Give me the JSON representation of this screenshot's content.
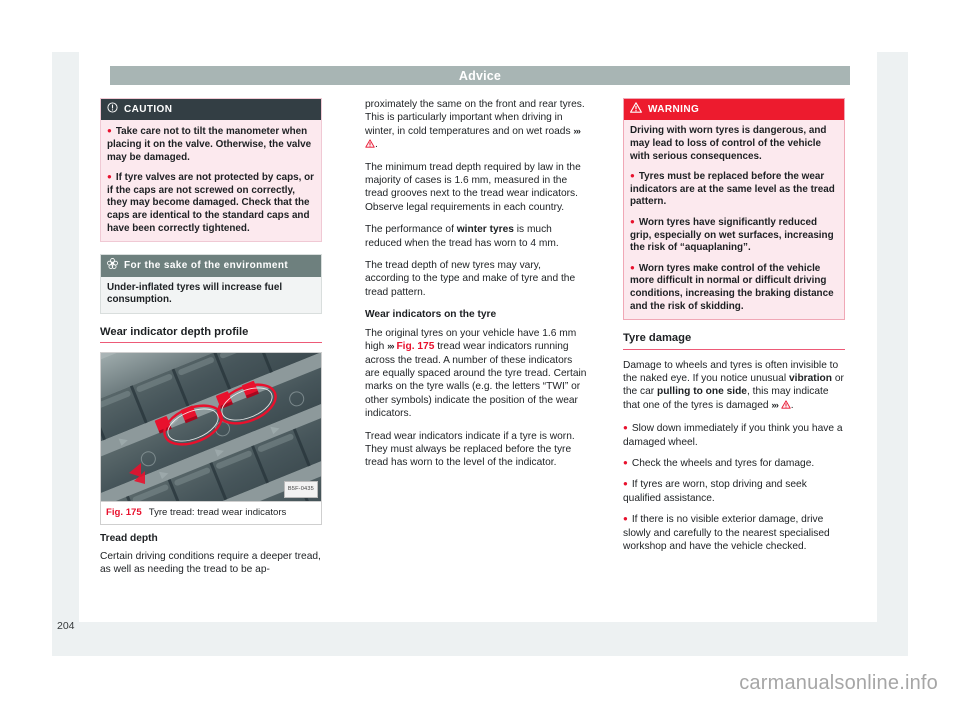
{
  "header": {
    "title": "Advice"
  },
  "page_number": "204",
  "watermark": "carmanualsonline.info",
  "column_left": {
    "caution_box": {
      "icon": "caution-circle-icon",
      "title": "CAUTION",
      "bullets": [
        "Take care not to tilt the manometer when placing it on the valve. Otherwise, the valve may be damaged.",
        "If tyre valves are not protected by caps, or if the caps are not screwed on correctly, they may become damaged. Check that the caps are identical to the standard caps and have been correctly tightened."
      ]
    },
    "environment_box": {
      "icon": "environment-flower-icon",
      "title": "For the sake of the environment",
      "text": "Under-inflated tyres will increase fuel consumption."
    },
    "section_title": "Wear indicator depth profile",
    "figure": {
      "label": "Fig. 175",
      "caption": "Tyre tread: tread wear indicators",
      "image_id": "B5F-0435",
      "alt": "Close-up of tyre tread with two red-circled tread wear indicators"
    },
    "subsection_title": "Tread depth",
    "body_text": "Certain driving conditions require a deeper tread, as well as needing the tread to be ap-"
  },
  "column_middle": {
    "para_1": "proximately the same on the front and rear tyres. This is particularly important when driving in winter, in cold temperatures and on wet roads",
    "para_1_ref_chevrons": "›››",
    "para_1_ref_icon": "warning-triangle-icon",
    "para_2": "The minimum tread depth required by law in the majority of cases is 1.6 mm, measured in the tread grooves next to the tread wear indicators. Observe legal requirements in each country.",
    "para_3_pre": "The performance of ",
    "para_3_bold": "winter tyres",
    "para_3_post": " is much reduced when the tread has worn to 4 mm.",
    "para_4": "The tread depth of new tyres may vary, according to the type and make of tyre and the tread pattern.",
    "subsection_title": "Wear indicators on the tyre",
    "para_5_pre": "The original tyres on your vehicle have 1.6 mm high ",
    "para_5_chevrons": "›››",
    "para_5_ref": "Fig. 175",
    "para_5_post": " tread wear indicators running across the tread. A number of these indicators are equally spaced around the tyre tread. Certain marks on the tyre walls (e.g. the letters “TWI” or other symbols) indicate the position of the wear indicators.",
    "para_6": "Tread wear indicators indicate if a tyre is worn. They must always be replaced before the tyre tread has worn to the level of the indicator."
  },
  "column_right": {
    "warning_box": {
      "icon": "warning-triangle-icon",
      "title": "WARNING",
      "intro": "Driving with worn tyres is dangerous, and may lead to loss of control of the vehicle with serious consequences.",
      "bullets": [
        "Tyres must be replaced before the wear indicators are at the same level as the tread pattern.",
        "Worn tyres have significantly reduced grip, especially on wet surfaces, increasing the risk of “aquaplaning”.",
        "Worn tyres make control of the vehicle more difficult in normal or difficult driving conditions, increasing the braking distance and the risk of skidding."
      ]
    },
    "section_title": "Tyre damage",
    "para_1_pre": "Damage to wheels and tyres is often invisible to the naked eye. If you notice unusual ",
    "para_1_bold_1": "vibration",
    "para_1_mid": " or the car ",
    "para_1_bold_2": "pulling to one side",
    "para_1_post": ", this may indicate that one of the tyres is damaged",
    "para_1_chevrons": "›››",
    "para_1_icon": "warning-triangle-icon",
    "bullets": [
      "Slow down immediately if you think you have a damaged wheel.",
      "Check the wheels and tyres for damage.",
      "If tyres are worn, stop driving and seek qualified assistance.",
      "If there is no visible exterior damage, drive slowly and carefully to the nearest specialised workshop and have the vehicle checked."
    ]
  },
  "colors": {
    "header_bar": "#a8b5b4",
    "caution_header": "#333e44",
    "warning_header": "#ed1b2e",
    "environment_header": "#6e807e",
    "notice_body": "#fce9ee",
    "accent_red": "#e8112d",
    "rule_pink": "#ed5a77",
    "page_background": "#edf1f2"
  }
}
